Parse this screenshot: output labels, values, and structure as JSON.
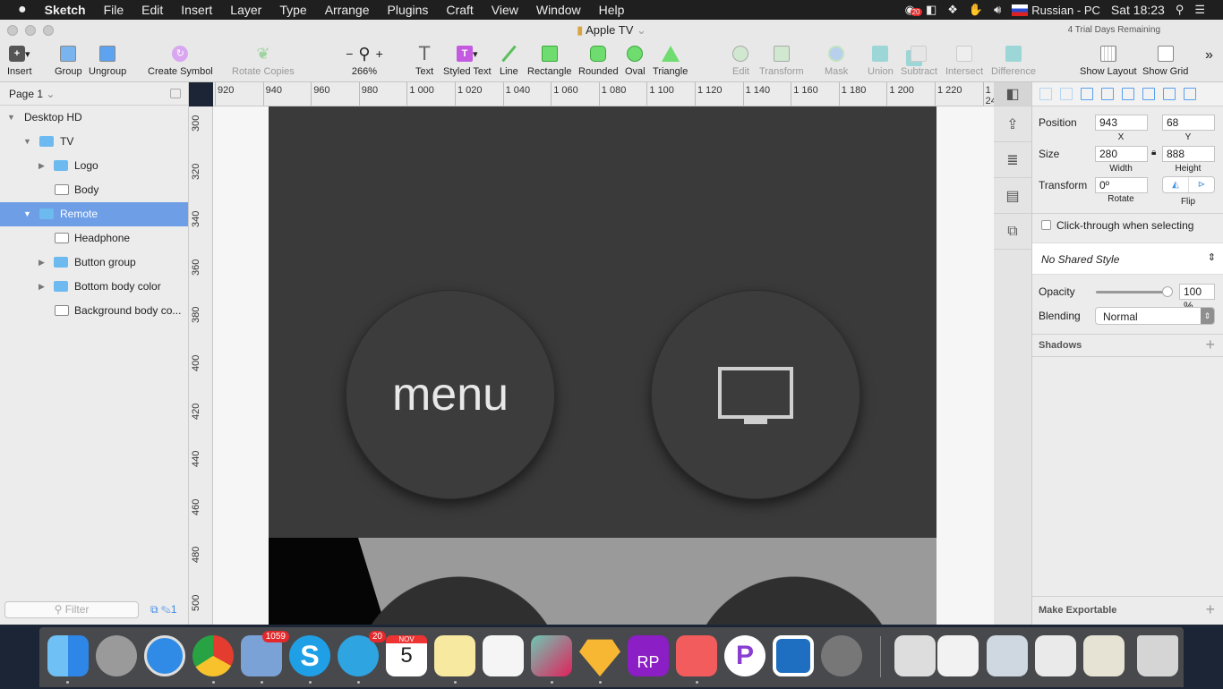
{
  "menubar": {
    "items": [
      "Sketch",
      "File",
      "Edit",
      "Insert",
      "Layer",
      "Type",
      "Arrange",
      "Plugins",
      "Craft",
      "View",
      "Window",
      "Help"
    ],
    "notification_badge": "20",
    "input_source": "Russian - PC",
    "clock": "Sat 18:23"
  },
  "window": {
    "title": "Apple TV",
    "trial": "4 Trial Days Remaining"
  },
  "toolbar": {
    "insert": "Insert",
    "group": "Group",
    "ungroup": "Ungroup",
    "create_symbol": "Create Symbol",
    "rotate_copies": "Rotate Copies",
    "zoom_minus": "−",
    "zoom_plus": "+",
    "zoom": "266%",
    "text": "Text",
    "styled_text": "Styled Text",
    "line": "Line",
    "rectangle": "Rectangle",
    "rounded": "Rounded",
    "oval": "Oval",
    "triangle": "Triangle",
    "edit": "Edit",
    "transform": "Transform",
    "mask": "Mask",
    "union": "Union",
    "subtract": "Subtract",
    "intersect": "Intersect",
    "difference": "Difference",
    "show_layout": "Show Layout",
    "show_grid": "Show Grid",
    "more": "»"
  },
  "page": {
    "label": "Page 1"
  },
  "layers": [
    {
      "name": "Desktop HD",
      "indent": 0,
      "type": "artboard"
    },
    {
      "name": "TV",
      "indent": 1,
      "type": "folder"
    },
    {
      "name": "Logo",
      "indent": 2,
      "type": "folder"
    },
    {
      "name": "Body",
      "indent": 2,
      "type": "shape"
    },
    {
      "name": "Remote",
      "indent": 1,
      "type": "folder",
      "selected": true
    },
    {
      "name": "Headphone",
      "indent": 2,
      "type": "shape"
    },
    {
      "name": "Button group",
      "indent": 2,
      "type": "folder"
    },
    {
      "name": "Bottom body color",
      "indent": 2,
      "type": "folder"
    },
    {
      "name": "Background body co...",
      "indent": 2,
      "type": "shape"
    }
  ],
  "filter": {
    "placeholder": "Filter",
    "count": "1"
  },
  "hruler": [
    "920",
    "940",
    "960",
    "980",
    "1 000",
    "1 020",
    "1 040",
    "1 060",
    "1 080",
    "1 100",
    "1 120",
    "1 140",
    "1 160",
    "1 180",
    "1 200",
    "1 220",
    "1 24"
  ],
  "vruler": [
    "300",
    "320",
    "340",
    "360",
    "380",
    "400",
    "420",
    "440",
    "460",
    "480",
    "500"
  ],
  "canvas": {
    "menu_button": "menu"
  },
  "inspector": {
    "position_label": "Position",
    "x": "943",
    "y": "68",
    "x_label": "X",
    "y_label": "Y",
    "size_label": "Size",
    "width": "280",
    "height": "888",
    "width_label": "Width",
    "height_label": "Height",
    "transform_label": "Transform",
    "rotate": "0º",
    "rotate_label": "Rotate",
    "flip_label": "Flip",
    "click_through": "Click-through when selecting",
    "shared_style": "No Shared Style",
    "opacity_label": "Opacity",
    "opacity": "100 %",
    "opacity_value": 100,
    "blending_label": "Blending",
    "blending": "Normal",
    "shadows": "Shadows",
    "make_exportable": "Make Exportable"
  },
  "dock": {
    "mail_badge": "1059",
    "telegram_badge": "20",
    "calendar_month": "NOV",
    "calendar_day": "5",
    "axure": "RP"
  }
}
